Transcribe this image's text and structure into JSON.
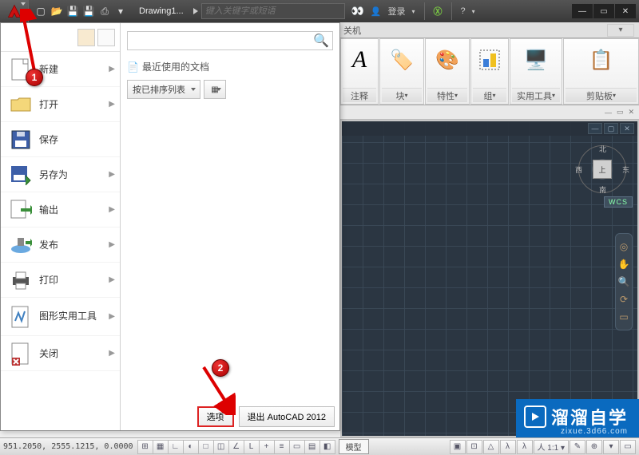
{
  "titlebar": {
    "doc_name": "Drawing1...",
    "search_placeholder": "键入关键字或短语",
    "login_label": "登录"
  },
  "app_menu": {
    "items": [
      {
        "label": "新建"
      },
      {
        "label": "打开"
      },
      {
        "label": "保存"
      },
      {
        "label": "另存为"
      },
      {
        "label": "输出"
      },
      {
        "label": "发布"
      },
      {
        "label": "打印"
      },
      {
        "label": "图形实用工具"
      },
      {
        "label": "关闭"
      }
    ],
    "recent_header": "最近使用的文档",
    "sort_dropdown": "按已排序列表",
    "options_btn": "选项",
    "exit_btn": "退出 AutoCAD 2012"
  },
  "ribbon": {
    "tab_partial": "关机",
    "panels": [
      {
        "label": "注释",
        "icon_letter": "A"
      },
      {
        "label": "块"
      },
      {
        "label": "特性"
      },
      {
        "label": "组"
      },
      {
        "label": "实用工具"
      },
      {
        "label": "剪贴板"
      }
    ]
  },
  "viewcube": {
    "face": "上",
    "dirs": {
      "n": "北",
      "s": "南",
      "e": "东",
      "w": "西"
    },
    "wcs": "WCS"
  },
  "status": {
    "coords": "951.2050,  2555.1215,  0.0000",
    "model_tab": "模型"
  },
  "annotations": {
    "badge1": "1",
    "badge2": "2"
  },
  "watermark": {
    "brand": "溜溜自学",
    "url": "zixue.3d66.com"
  }
}
